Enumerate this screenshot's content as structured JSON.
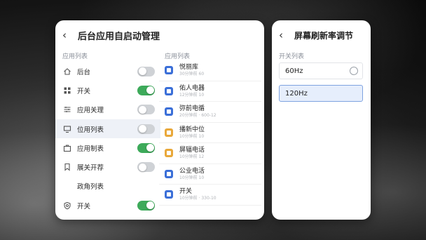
{
  "left_panel": {
    "title": "后台应用自启动管理",
    "section_left": "应用列表",
    "section_right": "应用列表",
    "settings": [
      {
        "label": "后台",
        "icon": "home-icon",
        "toggle": "off"
      },
      {
        "label": "开关",
        "icon": "grid-icon",
        "toggle": "on"
      },
      {
        "label": "应用关理",
        "icon": "list-icon",
        "toggle": "off"
      },
      {
        "label": "位用列表",
        "icon": "monitor-icon",
        "toggle": "off"
      },
      {
        "label": "应用制表",
        "icon": "briefcase-icon",
        "toggle": "on"
      },
      {
        "label": "展关开荐",
        "icon": "bookmark-icon",
        "toggle": "off"
      },
      {
        "label": "政角列表",
        "icon": "",
        "toggle": null
      },
      {
        "label": "开关",
        "icon": "shield-icon",
        "toggle": "on"
      }
    ],
    "apps": [
      {
        "name": "悦丽库",
        "sub": "30分钟前 60",
        "color": "#3b6fd8",
        "icon": "app-icon"
      },
      {
        "name": "佑人电器",
        "sub": "12分钟前 10",
        "color": "#3b6fd8",
        "icon": "app-icon"
      },
      {
        "name": "弥前电循",
        "sub": "20分钟前 · 600-12",
        "color": "#3b6fd8",
        "icon": "app-icon"
      },
      {
        "name": "播新中位",
        "sub": "10分钟前 10",
        "color": "#e9a83a",
        "icon": "app-icon"
      },
      {
        "name": "屏辐电话",
        "sub": "10分钟前 12",
        "color": "#e9a83a",
        "icon": "app-icon"
      },
      {
        "name": "公业电活",
        "sub": "10分钟前 10",
        "color": "#3b6fd8",
        "icon": "app-icon"
      },
      {
        "name": "开关",
        "sub": "10分钟前 · 330-10",
        "color": "#3b6fd8",
        "icon": "app-icon"
      }
    ]
  },
  "right_panel": {
    "title": "屏幕刷新率调节",
    "section": "开关列表",
    "options": [
      {
        "label": "60Hz",
        "selected": false
      },
      {
        "label": "120Hz",
        "selected": true
      }
    ]
  },
  "colors": {
    "toggle_on": "#3daa5a",
    "toggle_off": "#cfd2d6",
    "selected_bg": "#e6eefc",
    "selected_border": "#7ea3e0"
  }
}
